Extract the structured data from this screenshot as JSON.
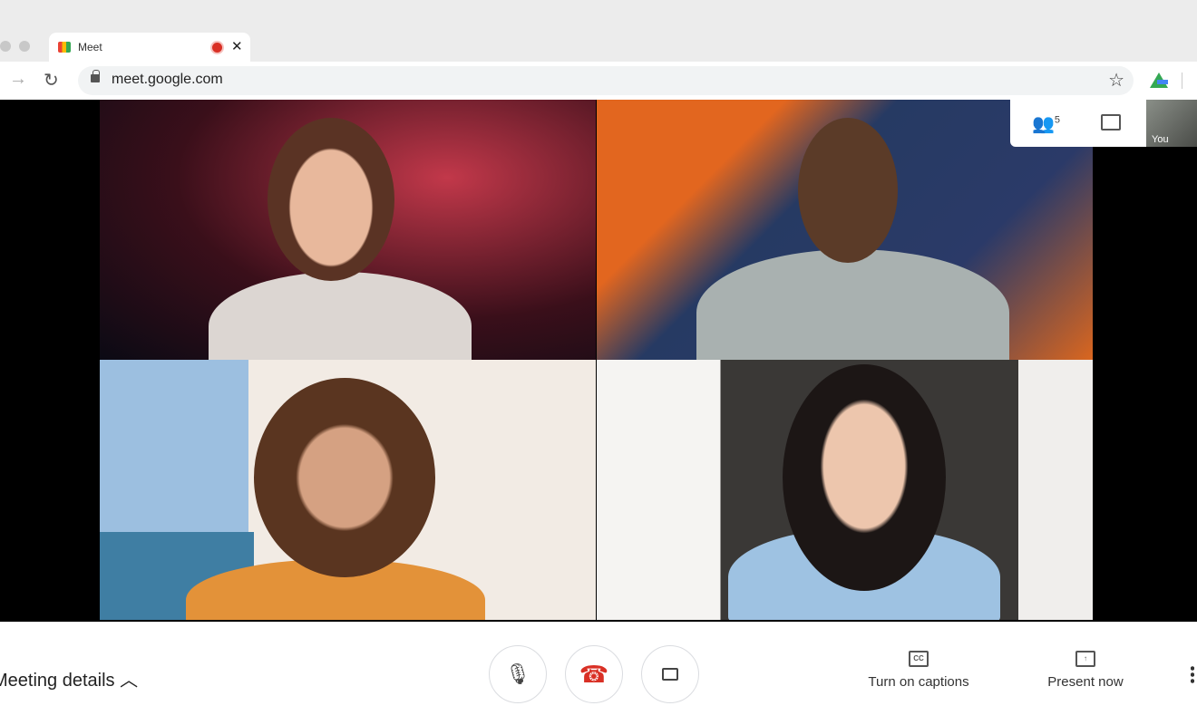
{
  "browser": {
    "tab_title": "Meet",
    "url": "meet.google.com"
  },
  "meet": {
    "participants_count": "5",
    "self_label": "You",
    "meeting_details": "Meeting details",
    "captions": "Turn on captions",
    "present": "Present now",
    "icons": [
      "people-icon",
      "chat-icon",
      "mic-icon",
      "end-call-icon",
      "camera-icon",
      "captions-icon",
      "present-icon",
      "more-icon"
    ],
    "colors": {
      "end_call": "#d93025",
      "recording": "#d93025"
    }
  }
}
